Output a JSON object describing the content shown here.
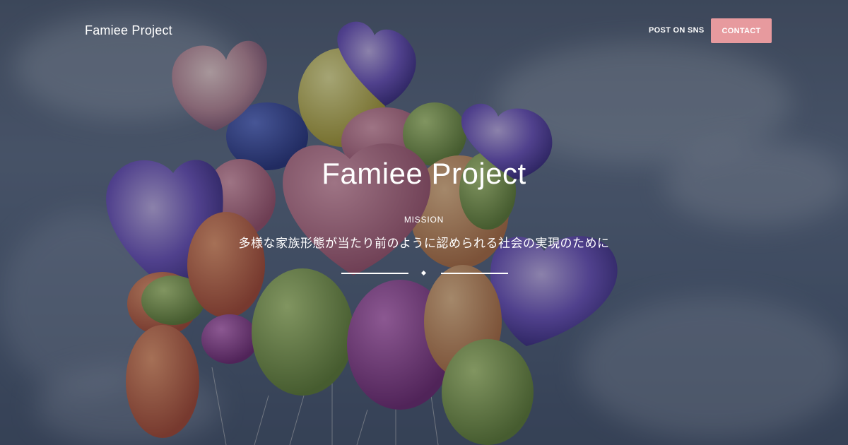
{
  "header": {
    "brand": "Famiee Project",
    "nav_post": "POST ON SNS",
    "nav_contact": "CONTACT"
  },
  "hero": {
    "title": "Famiee Project",
    "mission_label": "MISSION",
    "mission_text": "多様な家族形態が当たり前のように認められる社会の実現のために"
  },
  "colors": {
    "contact_button": "#e79a9e",
    "text": "#ffffff",
    "overlay": "#282c38"
  }
}
